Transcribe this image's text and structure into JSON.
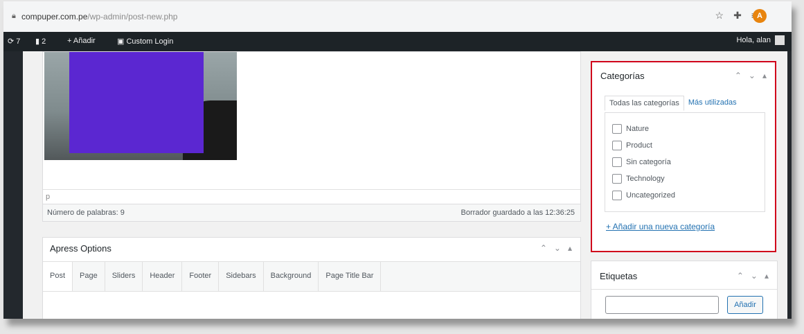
{
  "browser": {
    "url_host": "compuper.com.pe",
    "url_path": "/wp-admin/post-new.php",
    "icons": [
      "star-icon",
      "extensions-icon",
      "playlist-icon"
    ],
    "avatar_letter": "A"
  },
  "adminbar": {
    "updates_count": "7",
    "comments_count": "2",
    "new_label": "Añadir",
    "custom_login_label": "Custom Login",
    "greeting": "Hola, alan"
  },
  "editor": {
    "path": "p",
    "word_count": "Número de palabras: 9",
    "draft_status": "Borrador guardado a las 12:36:25"
  },
  "apress": {
    "title": "Apress Options",
    "tabs": [
      "Post",
      "Page",
      "Sliders",
      "Header",
      "Footer",
      "Sidebars",
      "Background",
      "Page Title Bar"
    ]
  },
  "categories": {
    "title": "Categorías",
    "tab_all": "Todas las categorías",
    "tab_most_used": "Más utilizadas",
    "items": [
      "Nature",
      "Product",
      "Sin categoría",
      "Technology",
      "Uncategorized"
    ],
    "add_link": "+ Añadir una nueva categoría"
  },
  "tags": {
    "title": "Etiquetas",
    "input_value": "",
    "add_button": "Añadir"
  },
  "colors": {
    "admin_bar": "#1d2327",
    "highlight_border": "#d0021b",
    "redaction": "#5b27d1",
    "link": "#2271b1"
  }
}
